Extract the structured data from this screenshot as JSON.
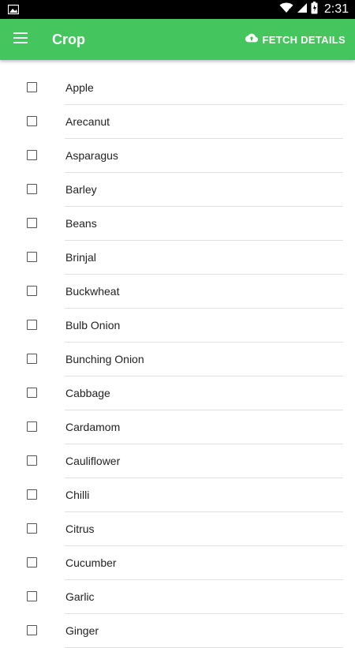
{
  "status_bar": {
    "time": "2:31",
    "icons": [
      "image-icon",
      "wifi-icon",
      "signal-icon",
      "battery-icon"
    ]
  },
  "app_bar": {
    "title": "Crop",
    "menu_icon": "hamburger-menu-icon",
    "fetch_label": "FETCH DETAILS",
    "fetch_icon": "cloud-upload-icon",
    "color": "#44c55e"
  },
  "crops": [
    {
      "label": "Apple",
      "checked": false
    },
    {
      "label": "Arecanut",
      "checked": false
    },
    {
      "label": "Asparagus",
      "checked": false
    },
    {
      "label": "Barley",
      "checked": false
    },
    {
      "label": "Beans",
      "checked": false
    },
    {
      "label": "Brinjal",
      "checked": false
    },
    {
      "label": "Buckwheat",
      "checked": false
    },
    {
      "label": "Bulb Onion",
      "checked": false
    },
    {
      "label": "Bunching Onion",
      "checked": false
    },
    {
      "label": "Cabbage",
      "checked": false
    },
    {
      "label": "Cardamom",
      "checked": false
    },
    {
      "label": "Cauliflower",
      "checked": false
    },
    {
      "label": "Chilli",
      "checked": false
    },
    {
      "label": "Citrus",
      "checked": false
    },
    {
      "label": "Cucumber",
      "checked": false
    },
    {
      "label": "Garlic",
      "checked": false
    },
    {
      "label": "Ginger",
      "checked": false
    }
  ]
}
